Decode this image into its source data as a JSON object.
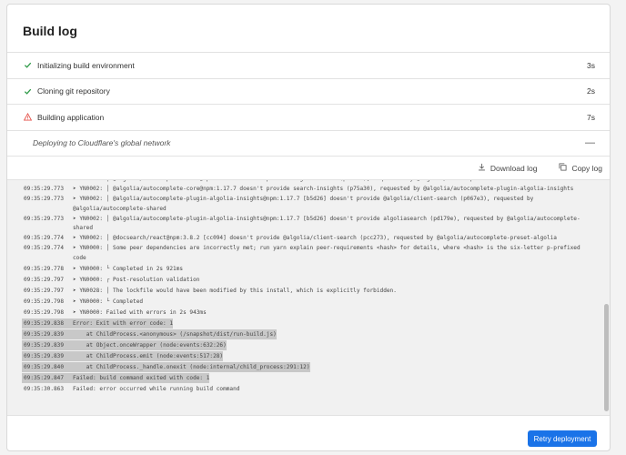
{
  "title": "Build log",
  "colors": {
    "accent": "#1a73e8",
    "success": "#2e9a47",
    "warning": "#e5534b"
  },
  "steps": [
    {
      "label": "Initializing build environment",
      "duration": "3s",
      "icon": "check-icon"
    },
    {
      "label": "Cloning git repository",
      "duration": "2s",
      "icon": "check-icon"
    },
    {
      "label": "Building application",
      "duration": "7s",
      "icon": "warning-icon"
    },
    {
      "label": "Deploying to Cloudflare's global network",
      "duration": "—",
      "icon": "none"
    }
  ],
  "toolbar": {
    "download_label": "Download log",
    "copy_label": "Copy log"
  },
  "log": [
    {
      "ts": "09:35:29.773",
      "msg": "➤ YN0002: │ @algolia/autocomplete-core@npm:1.17.7 doesn't provide algoliasearch (pf6667), requested by @algolia/autocomplete-shared",
      "hl": false
    },
    {
      "ts": "09:35:29.773",
      "msg": "➤ YN0002: │ @algolia/autocomplete-core@npm:1.17.7 doesn't provide search-insights (p75a30), requested by @algolia/autocomplete-plugin-algolia-insights",
      "hl": false
    },
    {
      "ts": "09:35:29.773",
      "msg": "➤ YN0002: │ @algolia/autocomplete-plugin-algolia-insights@npm:1.17.7 [b5d26] doesn't provide @algolia/client-search (p067e3), requested by @algolia/autocomplete-shared",
      "hl": false
    },
    {
      "ts": "09:35:29.773",
      "msg": "➤ YN0002: │ @algolia/autocomplete-plugin-algolia-insights@npm:1.17.7 [b5d26] doesn't provide algoliasearch (pd179e), requested by @algolia/autocomplete-shared",
      "hl": false
    },
    {
      "ts": "09:35:29.774",
      "msg": "➤ YN0002: │ @docsearch/react@npm:3.8.2 [cc094] doesn't provide @algolia/client-search (pcc273), requested by @algolia/autocomplete-preset-algolia",
      "hl": false
    },
    {
      "ts": "09:35:29.774",
      "msg": "➤ YN0000: │ Some peer dependencies are incorrectly met; run yarn explain peer-requirements <hash> for details, where <hash> is the six-letter p-prefixed code",
      "hl": false
    },
    {
      "ts": "09:35:29.778",
      "msg": "➤ YN0000: └ Completed in 2s 921ms",
      "hl": false
    },
    {
      "ts": "09:35:29.797",
      "msg": "➤ YN0000: ┌ Post-resolution validation",
      "hl": false
    },
    {
      "ts": "09:35:29.797",
      "msg": "➤ YN0028: │ The lockfile would have been modified by this install, which is explicitly forbidden.",
      "hl": false
    },
    {
      "ts": "09:35:29.798",
      "msg": "➤ YN0000: └ Completed",
      "hl": false
    },
    {
      "ts": "09:35:29.798",
      "msg": "➤ YN0000: Failed with errors in 2s 943ms",
      "hl": false
    },
    {
      "ts": "09:35:29.838",
      "msg": "Error: Exit with error code: 1",
      "hl": true
    },
    {
      "ts": "09:35:29.839",
      "msg": "    at ChildProcess.<anonymous> (/snapshot/dist/run-build.js)",
      "hl": true
    },
    {
      "ts": "09:35:29.839",
      "msg": "    at Object.onceWrapper (node:events:632:26)",
      "hl": true
    },
    {
      "ts": "09:35:29.839",
      "msg": "    at ChildProcess.emit (node:events:517:28)",
      "hl": true
    },
    {
      "ts": "09:35:29.840",
      "msg": "    at ChildProcess._handle.onexit (node:internal/child_process:291:12)",
      "hl": true
    },
    {
      "ts": "09:35:29.847",
      "msg": "Failed: build command exited with code: 1",
      "hl": true
    },
    {
      "ts": "09:35:30.863",
      "msg": "Failed: error occurred while running build command",
      "hl": false
    }
  ],
  "retry_label": "Retry deployment"
}
